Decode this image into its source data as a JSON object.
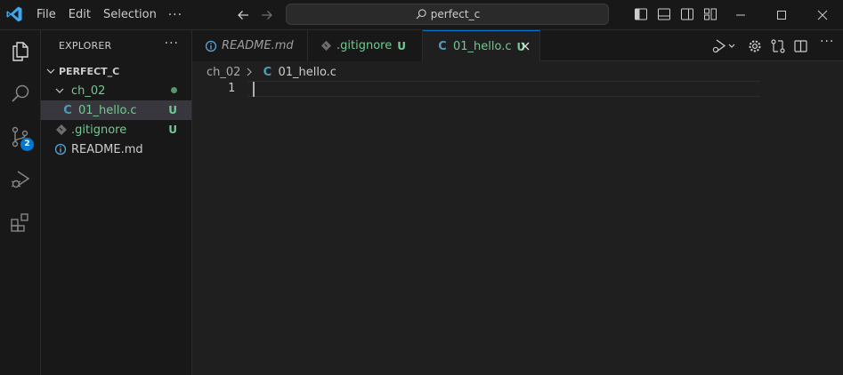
{
  "titlebar": {
    "menu": [
      "File",
      "Edit",
      "Selection"
    ],
    "more": "···",
    "search": "perfect_c",
    "layout_icons": [
      "toggle-primary-sidebar-icon",
      "toggle-panel-icon",
      "toggle-secondary-sidebar-icon",
      "customize-layout-icon"
    ],
    "window_controls": [
      "minimize-icon",
      "maximize-icon",
      "close-icon"
    ]
  },
  "activitybar": {
    "items": [
      "explorer-icon",
      "search-icon",
      "source-control-icon",
      "run-debug-icon",
      "extensions-icon"
    ],
    "source_control_badge": "2"
  },
  "explorer": {
    "header": "EXPLORER",
    "more": "···",
    "root": "PERFECT_C",
    "items": [
      {
        "label": "ch_02"
      },
      {
        "label": "01_hello.c",
        "status": "U",
        "icon": "C"
      },
      {
        "label": ".gitignore",
        "status": "U"
      },
      {
        "label": "README.md"
      }
    ]
  },
  "tabs": [
    {
      "label": "README.md"
    },
    {
      "label": ".gitignore",
      "status": "U"
    },
    {
      "label": "01_hello.c",
      "status": "U",
      "icon": "C"
    }
  ],
  "editor": {
    "breadcrumb": [
      "ch_02",
      "01_hello.c"
    ],
    "breadcrumb_icon": "C",
    "line_number": "1"
  },
  "colors": {
    "accent": "#0078d4",
    "untracked": "#73c991",
    "c_icon": "#519aba"
  }
}
